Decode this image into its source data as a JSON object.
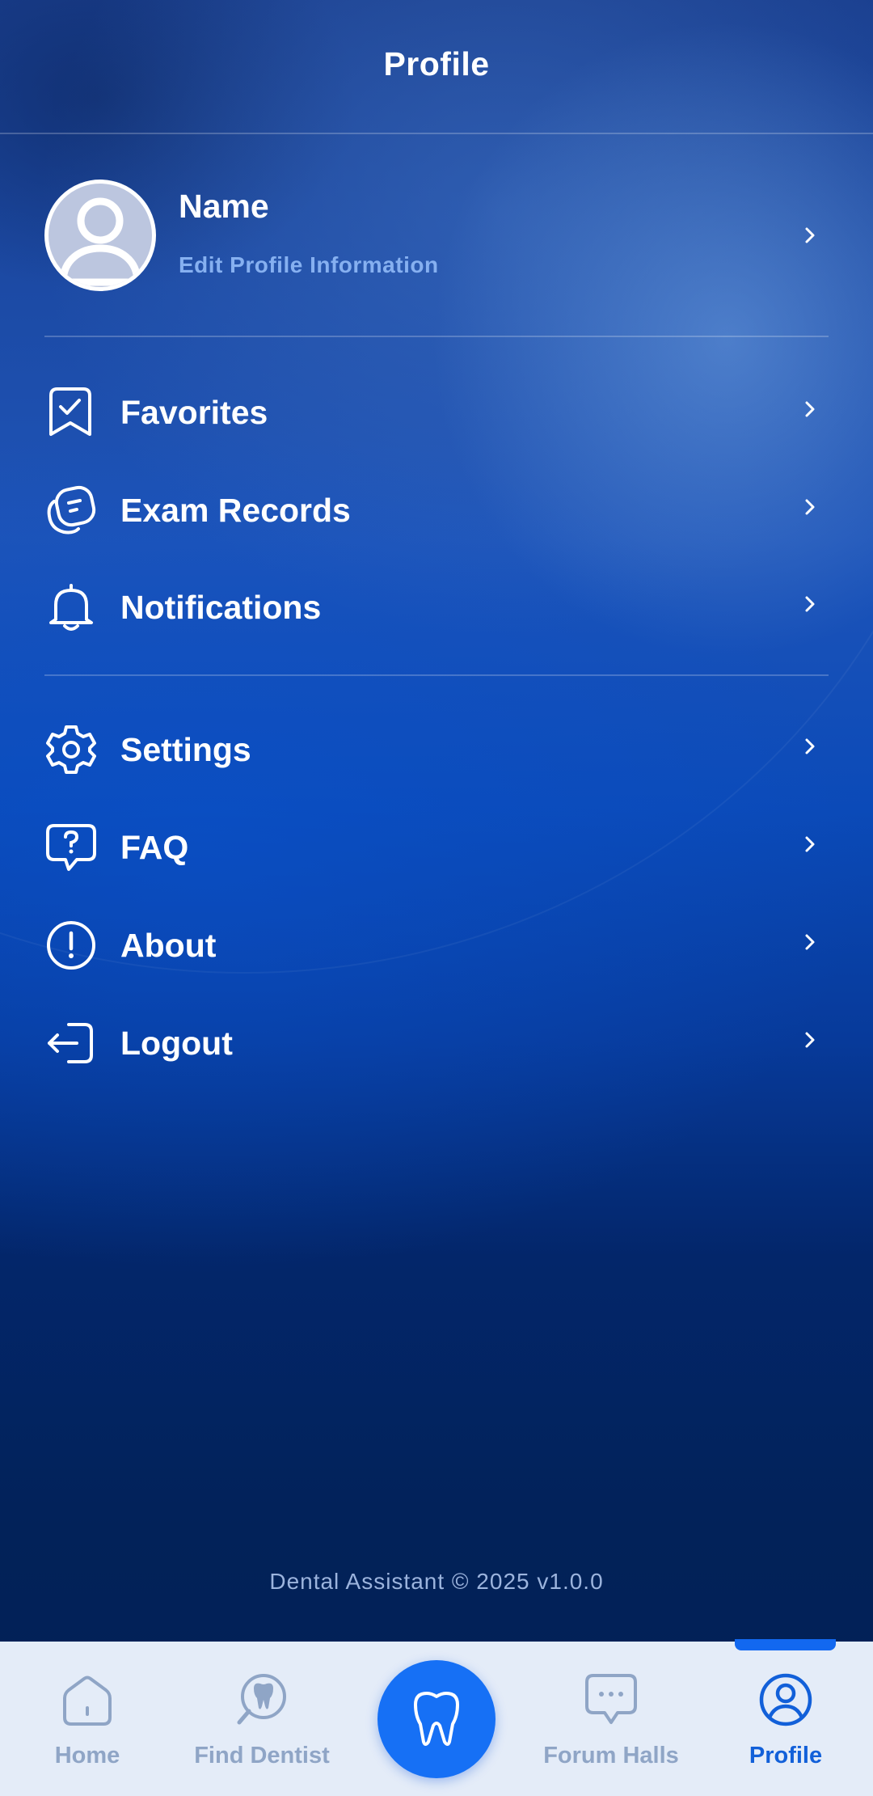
{
  "header": {
    "title": "Profile"
  },
  "profile": {
    "name": "Name",
    "edit_label": "Edit Profile Information"
  },
  "menu": {
    "group1": [
      {
        "label": "Favorites",
        "icon": "bookmark-check-icon"
      },
      {
        "label": "Exam Records",
        "icon": "records-icon"
      },
      {
        "label": "Notifications",
        "icon": "bell-icon"
      }
    ],
    "group2": [
      {
        "label": "Settings",
        "icon": "gear-icon"
      },
      {
        "label": "FAQ",
        "icon": "question-bubble-icon"
      },
      {
        "label": "About",
        "icon": "info-icon"
      },
      {
        "label": "Logout",
        "icon": "logout-icon"
      }
    ]
  },
  "footer": {
    "text": "Dental Assistant © 2025  v1.0.0"
  },
  "tabbar": {
    "tabs": [
      {
        "label": "Home",
        "icon": "home-icon"
      },
      {
        "label": "Find Dentist",
        "icon": "find-dentist-icon"
      },
      {
        "label": "",
        "icon": "tooth-icon"
      },
      {
        "label": "Forum Halls",
        "icon": "chat-bubble-icon"
      },
      {
        "label": "Profile",
        "icon": "user-circle-icon"
      }
    ],
    "active": "Profile"
  },
  "colors": {
    "accent": "#1670f5",
    "active_tab": "#1260d9",
    "inactive_tab": "#8fa5c6",
    "tabbar_bg": "#e4ecf8",
    "edit_link": "#86b0f0"
  }
}
